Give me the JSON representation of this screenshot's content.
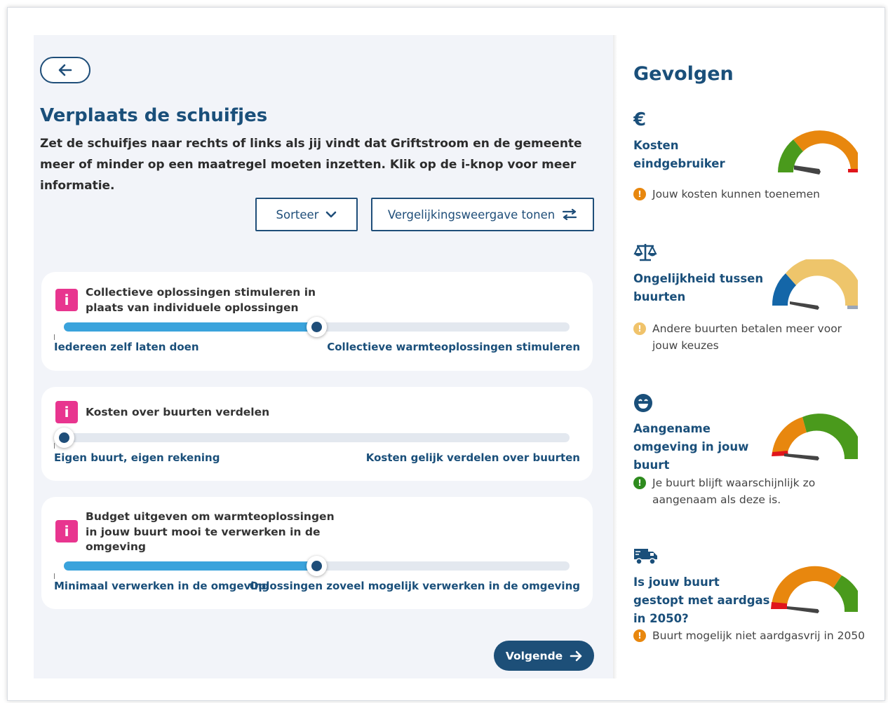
{
  "header": {
    "back_button": "back-arrow",
    "title": "Verplaats de schuifjes",
    "intro": "Zet de schuifjes naar rechts of links als jij vindt dat Griftstroom en de gemeente meer of minder op een maatregel moeten inzetten. Klik op de i-knop voor meer informatie."
  },
  "toolbar": {
    "sort_label": "Sorteer",
    "compare_label": "Vergelijkingsweergave tonen"
  },
  "sliders": [
    {
      "title": "Collectieve oplossingen stimuleren in plaats van individuele oplossingen",
      "left_label": "Iedereen zelf laten doen",
      "right_label": "Collectieve warmteoplossingen stimuleren",
      "value": 0.5
    },
    {
      "title": "Kosten over buurten verdelen",
      "left_label": "Eigen buurt, eigen rekening",
      "right_label": "Kosten gelijk verdelen over buurten",
      "value": 0.0
    },
    {
      "title": "Budget uitgeven om warmteoplossingen in jouw buurt mooi te verwerken in de omgeving",
      "left_label": "Minimaal verwerken in de omgeving",
      "right_label": "Oplossingen zoveel mogelijk verwerken in de omgeving",
      "value": 0.5
    }
  ],
  "next_button": "Volgende",
  "consequences": {
    "title": "Gevolgen",
    "items": [
      {
        "icon": "euro-icon",
        "title_lines": [
          "Kosten",
          "eindgebruiker"
        ],
        "note": "Jouw kosten kunnen toenemen",
        "note_color": "#e8870e"
      },
      {
        "icon": "scale-icon",
        "title_lines": [
          "Ongelijkheid tussen",
          "buurten"
        ],
        "note": "Andere buurten betalen meer voor jouw keuzes",
        "note_color": "#f0c36b"
      },
      {
        "icon": "smile-icon",
        "title_lines": [
          "Aangename",
          "omgeving in jouw",
          "buurt"
        ],
        "note": "Je buurt blijft waarschijnlijk zo aangenaam als deze is.",
        "note_color": "#2e8b1e"
      },
      {
        "icon": "truck-icon",
        "title_lines": [
          "Is jouw buurt",
          "gestopt met aardgas",
          "in 2050?"
        ],
        "note": "Buurt mogelijk niet aardgasvrij in 2050",
        "note_color": "#e8870e"
      }
    ]
  },
  "colors": {
    "primary": "#1f4e79",
    "accent_blue": "#3aa3dc",
    "info_pink": "#e8358f",
    "gauge_green": "#4a9a1c",
    "gauge_orange": "#e8870e",
    "gauge_red": "#e0151b",
    "gauge_yellow": "#eec56b",
    "gauge_blue": "#1466a8"
  }
}
